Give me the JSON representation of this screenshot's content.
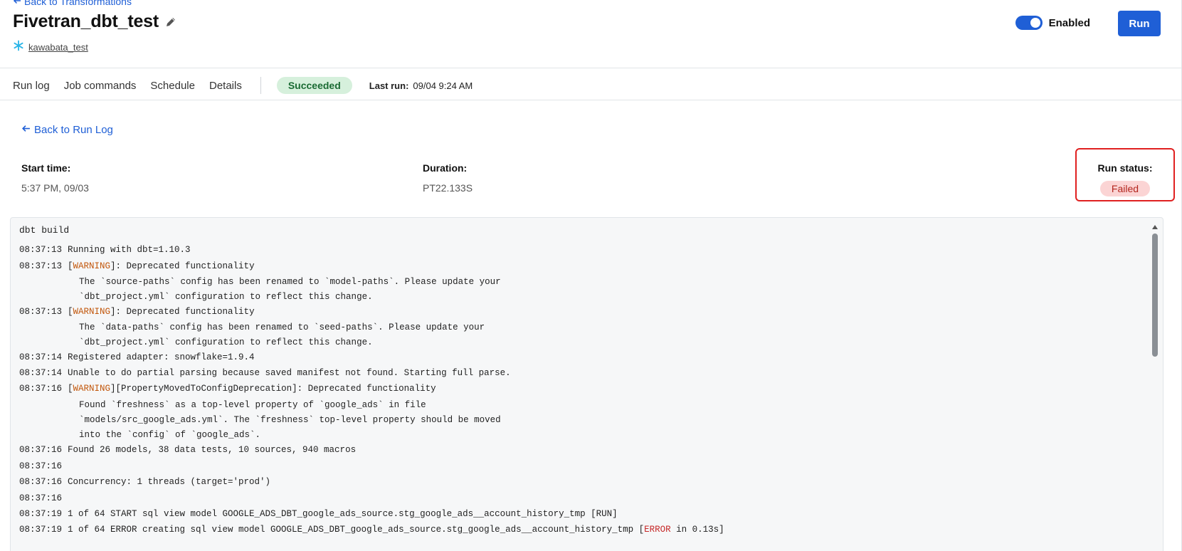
{
  "header": {
    "back_link": "Back to Transformations",
    "title": "Fivetran_dbt_test",
    "destination": "kawabata_test",
    "toggle_label": "Enabled",
    "run_label": "Run"
  },
  "tabs": {
    "items": [
      "Run log",
      "Job commands",
      "Schedule",
      "Details"
    ],
    "status_badge": "Succeeded",
    "last_run_label": "Last run:",
    "last_run_value": "09/04 9:24 AM"
  },
  "detail": {
    "back_link": "Back to Run Log",
    "start_time_label": "Start time:",
    "start_time_value": "5:37 PM, 09/03",
    "duration_label": "Duration:",
    "duration_value": "PT22.133S",
    "run_status_label": "Run status:",
    "run_status_value": "Failed"
  },
  "log": {
    "command": "dbt build",
    "lines": [
      {
        "ts": "08:37:13",
        "text": "Running with dbt=1.10.3"
      },
      {
        "ts": "08:37:13",
        "pre": "[",
        "tag": "WARNING",
        "post": "]: Deprecated functionality"
      },
      {
        "cont": "The `source-paths` config has been renamed to `model-paths`. Please update your"
      },
      {
        "cont": "`dbt_project.yml` configuration to reflect this change."
      },
      {
        "ts": "08:37:13",
        "pre": "[",
        "tag": "WARNING",
        "post": "]: Deprecated functionality"
      },
      {
        "cont": "The `data-paths` config has been renamed to `seed-paths`. Please update your"
      },
      {
        "cont": "`dbt_project.yml` configuration to reflect this change."
      },
      {
        "ts": "08:37:14",
        "text": "Registered adapter: snowflake=1.9.4"
      },
      {
        "ts": "08:37:14",
        "text": "Unable to do partial parsing because saved manifest not found. Starting full parse."
      },
      {
        "ts": "08:37:16",
        "pre": "[",
        "tag": "WARNING",
        "post": "][PropertyMovedToConfigDeprecation]: Deprecated functionality"
      },
      {
        "cont": "Found `freshness` as a top-level property of `google_ads` in file"
      },
      {
        "cont": "`models/src_google_ads.yml`. The `freshness` top-level property should be moved"
      },
      {
        "cont": "into the `config` of `google_ads`."
      },
      {
        "ts": "08:37:16",
        "text": "Found 26 models, 38 data tests, 10 sources, 940 macros"
      },
      {
        "ts": "08:37:16",
        "text": ""
      },
      {
        "ts": "08:37:16",
        "text": "Concurrency: 1 threads (target='prod')"
      },
      {
        "ts": "08:37:16",
        "text": ""
      },
      {
        "ts": "08:37:19",
        "text": "1 of 64 START sql view model GOOGLE_ADS_DBT_google_ads_source.stg_google_ads__account_history_tmp [RUN]"
      },
      {
        "ts": "08:37:19",
        "pre": "1 of 64 ERROR creating sql view model GOOGLE_ADS_DBT_google_ads_source.stg_google_ads__account_history_tmp [",
        "tag": "ERROR",
        "post": " in 0.13s]",
        "tagtype": "error"
      }
    ]
  }
}
